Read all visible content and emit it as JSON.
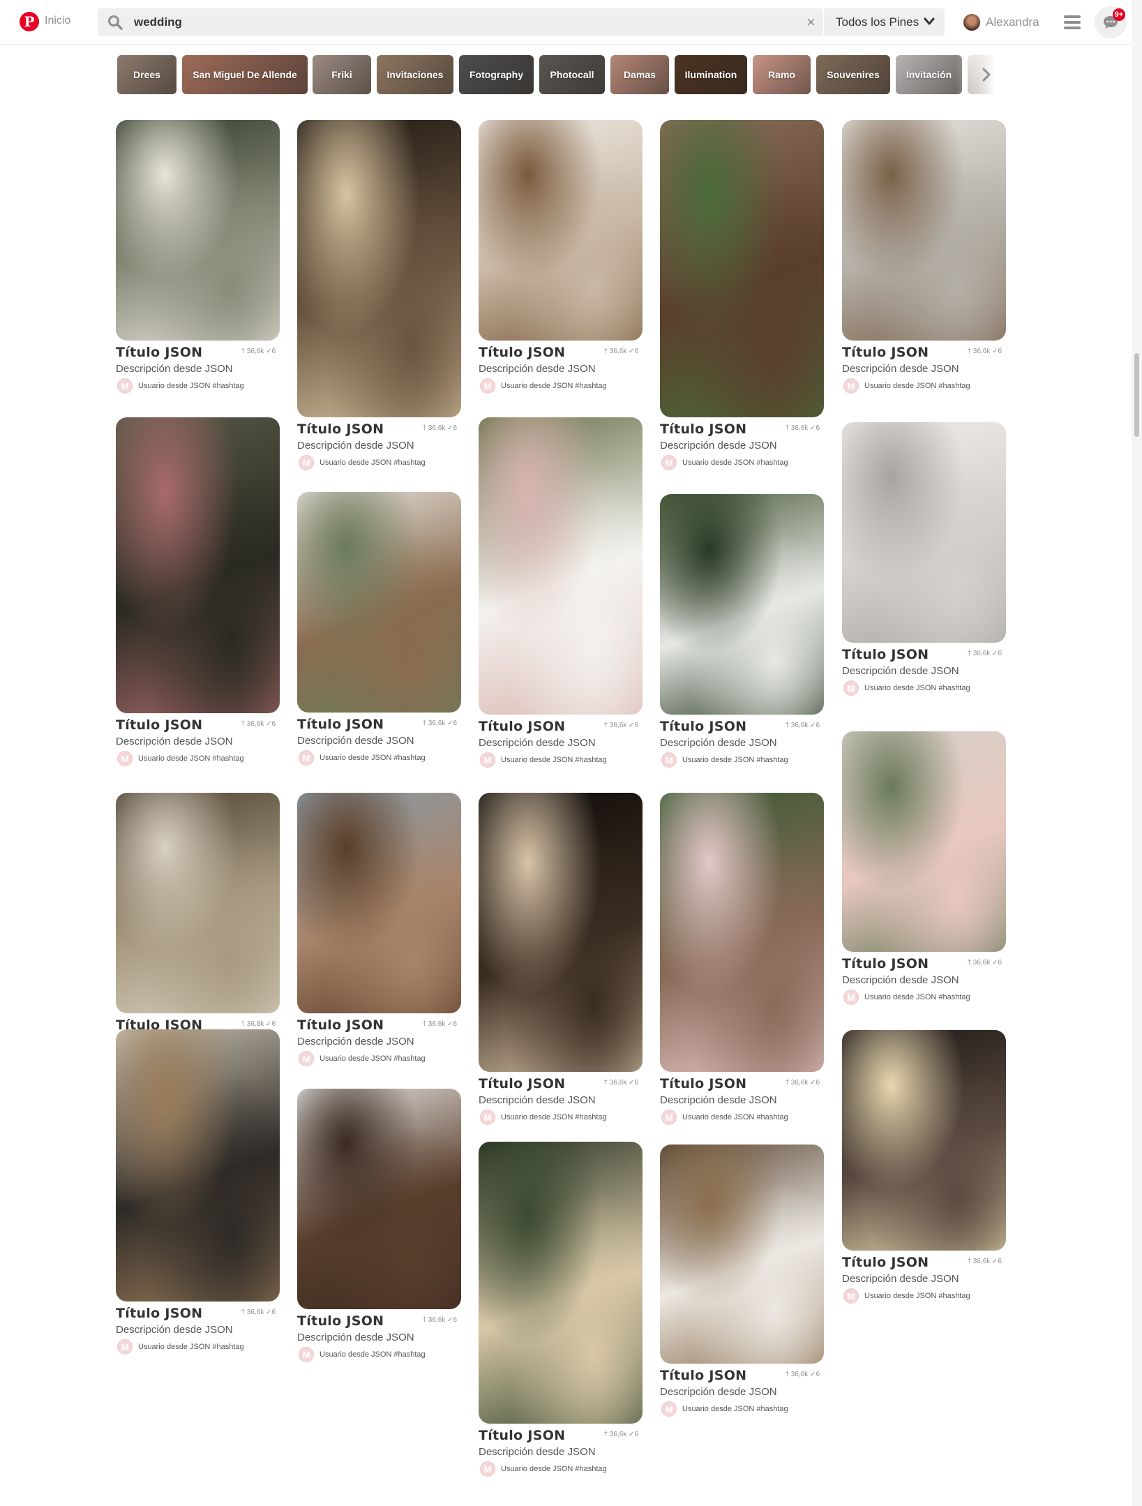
{
  "header": {
    "logo_letter": "P",
    "home_label": "Inicio",
    "search_value": "wedding",
    "clear_symbol": "×",
    "scope_label": "Todos los Pines",
    "user_name": "Alexandra",
    "notif_count": "9+"
  },
  "icons": {
    "logo": "pinterest-logo",
    "search": "search-icon",
    "clear": "close-icon",
    "scope": "chevron-down-icon",
    "menu": "menu-icon",
    "chat": "chat-icon",
    "more_guides": "chevron-right-icon"
  },
  "guides": [
    {
      "label": "Drees",
      "color": "#8c7a6c"
    },
    {
      "label": "San Miguel De Allende",
      "color": "#9c6a58"
    },
    {
      "label": "Friki",
      "color": "#9b8a80"
    },
    {
      "label": "Invitaciones",
      "color": "#8d7660"
    },
    {
      "label": "Fotography",
      "color": "#4d4d4d"
    },
    {
      "label": "Photocall",
      "color": "#595550"
    },
    {
      "label": "Damas",
      "color": "#b48676"
    },
    {
      "label": "Ilumination",
      "color": "#4a3220"
    },
    {
      "label": "Ramo",
      "color": "#c89484"
    },
    {
      "label": "Souvenires",
      "color": "#7e6a58"
    },
    {
      "label": "Invitación",
      "color": "#b9b4b4"
    },
    {
      "label": "",
      "color": "#e4dcd6"
    }
  ],
  "pins": [
    {
      "title": "Título JSON",
      "description": "Descripción desde JSON",
      "saves": "36,6k",
      "tries": "6",
      "user": "Usuario desde JSON #hashtag",
      "user_initial": "M",
      "image": "fairy-lights-forest-reception",
      "colors": [
        "#2f3a26",
        "#8a8c7a",
        "#e8e4da"
      ]
    },
    {
      "title": "Título JSON",
      "description": "Descripción desde JSON",
      "saves": "36,6k",
      "tries": "6",
      "user": "Usuario desde JSON #hashtag",
      "user_initial": "M",
      "image": "string-lights-long-table-tent",
      "colors": [
        "#1e1812",
        "#6a5540",
        "#d8c4a0"
      ]
    },
    {
      "title": "Título JSON",
      "description": "Descripción desde JSON",
      "saves": "36,6k",
      "tries": "6",
      "user": "Usuario desde JSON #hashtag",
      "user_initial": "M",
      "image": "rustic-centerpiece-wood-slice",
      "colors": [
        "#f0ece6",
        "#c8b8a4",
        "#7a5a3c"
      ]
    },
    {
      "title": "Título JSON",
      "description": "Descripción desde JSON",
      "saves": "36,6k",
      "tries": "6",
      "user": "Usuario desde JSON #hashtag",
      "user_initial": "M",
      "image": "welcome-sign-alex-rachel",
      "colors": [
        "#8a6e5a",
        "#5a3e2c",
        "#4a6a3a"
      ]
    },
    {
      "title": "Título JSON",
      "description": "Descripción desde JSON",
      "saves": "36,6k",
      "tries": "6",
      "user": "Usuario desde JSON #hashtag",
      "user_initial": "M",
      "image": "lakeside-reception-tables",
      "colors": [
        "#e8e6e0",
        "#b4b0a8",
        "#7a6048"
      ]
    },
    {
      "title": "Título JSON",
      "description": "Descripción desde JSON",
      "saves": "36,6k",
      "tries": "6",
      "user": "Usuario desde JSON #hashtag",
      "user_initial": "M",
      "image": "hanging-lanterns-flowers",
      "colors": [
        "#5a5a48",
        "#2a2a22",
        "#a86a6a"
      ]
    },
    {
      "title": "Título JSON",
      "description": "Descripción desde JSON",
      "saves": "36,6k",
      "tries": "6",
      "user": "Usuario desde JSON #hashtag",
      "user_initial": "M",
      "image": "chair-sashes-greenery",
      "colors": [
        "#e8e4de",
        "#8a6c50",
        "#6a7a5a"
      ]
    },
    {
      "title": "Título JSON",
      "description": "Descripción desde JSON",
      "saves": "36,6k",
      "tries": "6",
      "user": "Usuario desde JSON #hashtag",
      "user_initial": "M",
      "image": "white-cake-succulents",
      "colors": [
        "#6a7048",
        "#f4f2ee",
        "#d8b4b0"
      ]
    },
    {
      "title": "Título JSON",
      "description": "Descripción desde JSON",
      "saves": "36,6k",
      "tries": "6",
      "user": "Usuario desde JSON #hashtag",
      "user_initial": "M",
      "image": "white-drapes-forest-aisle",
      "colors": [
        "#4a5a3a",
        "#e6e8e4",
        "#2a3a24"
      ]
    },
    {
      "title": "Título JSON",
      "description": "Descripción desde JSON",
      "saves": "36,6k",
      "tries": "6",
      "user": "Usuario desde JSON #hashtag",
      "user_initial": "M",
      "image": "pastel-bridal-bouquet",
      "colors": [
        "#d4cfc6",
        "#e8c8c0",
        "#6a7a5a"
      ]
    },
    {
      "title": "Título JSON",
      "description": "Descripción desde JSON",
      "saves": "36,6k",
      "tries": "6",
      "user": "Usuario desde JSON #hashtag",
      "user_initial": "M",
      "image": "mason-jar-fairy-lights",
      "colors": [
        "#4a3e30",
        "#a89a80",
        "#d8d0c0"
      ]
    },
    {
      "title": "Título JSON",
      "description": "Descripción desde JSON",
      "saves": "36,6k",
      "tries": "6",
      "user": "Usuario desde JSON #hashtag",
      "user_initial": "M",
      "image": "dessert-table-wine-barrels",
      "colors": [
        "#8a9aa4",
        "#a8846a",
        "#5a3e28"
      ]
    },
    {
      "title": "Título JSON",
      "description": "Descripción desde JSON",
      "saves": "36,6k",
      "tries": "6",
      "user": "Usuario desde JSON #hashtag",
      "user_initial": "M",
      "image": "sky-lanterns-couple-night",
      "colors": [
        "#0e0c0a",
        "#3a2c20",
        "#d8c4a8"
      ]
    },
    {
      "title": "Título JSON",
      "description": "Descripción desde JSON",
      "saves": "36,6k",
      "tries": "6",
      "user": "Usuario desde JSON #hashtag",
      "user_initial": "M",
      "image": "wood-pallet-floral-backdrop",
      "colors": [
        "#3a5a34",
        "#8a6a58",
        "#e4c8c8"
      ]
    },
    {
      "title": "Título JSON",
      "description": "Descripción desde JSON",
      "saves": "36,6k",
      "tries": "6",
      "user": "Usuario desde JSON #hashtag",
      "user_initial": "M",
      "image": "sparkler-send-off",
      "colors": [
        "#1a1614",
        "#5a4a40",
        "#e8d8b0"
      ]
    },
    {
      "title": "Título JSON",
      "description": "Descripción desde JSON",
      "saves": "36,6k",
      "tries": "6",
      "user": "Usuario desde JSON #hashtag",
      "user_initial": "M",
      "image": "chalkboard-soundtrack-sign",
      "colors": [
        "#c8c0b0",
        "#2e2a26",
        "#9a7c5a"
      ]
    },
    {
      "title": "Título JSON",
      "description": "Descripción desde JSON",
      "saves": "36,6k",
      "tries": "6",
      "user": "Usuario desde JSON #hashtag",
      "user_initial": "M",
      "image": "bridal-hair-vine",
      "colors": [
        "#e8e6e4",
        "#5a3e2c",
        "#3a2a20"
      ]
    },
    {
      "title": "Título JSON",
      "description": "Descripción desde JSON",
      "saves": "36,6k",
      "tries": "6",
      "user": "Usuario desde JSON #hashtag",
      "user_initial": "M",
      "image": "candles-greenery-aisle",
      "colors": [
        "#2a3424",
        "#d8c8a8",
        "#3a4a30"
      ]
    },
    {
      "title": "Título JSON",
      "description": "Descripción desde JSON",
      "saves": "36,6k",
      "tries": "6",
      "user": "Usuario desde JSON #hashtag",
      "user_initial": "M",
      "image": "hydrangea-stairs-candles",
      "colors": [
        "#5a4634",
        "#ece8e2",
        "#8a6e4e"
      ]
    },
    {
      "title": "Título JSON",
      "description": "Descripción desde JSON",
      "saves": "36,6k",
      "tries": "6",
      "user": "Usuario desde JSON #hashtag",
      "user_initial": "M",
      "image": "lace-wedding-sneakers",
      "colors": [
        "#f0eeec",
        "#d4d0cc",
        "#a8a4a0"
      ]
    }
  ]
}
